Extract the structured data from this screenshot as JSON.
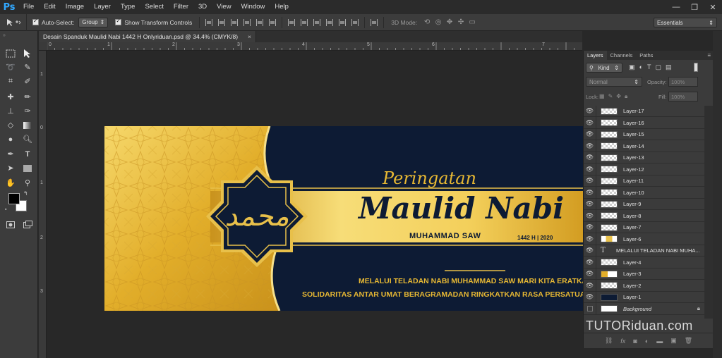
{
  "app": {
    "logo": "Ps"
  },
  "menu": [
    "File",
    "Edit",
    "Image",
    "Layer",
    "Type",
    "Select",
    "Filter",
    "3D",
    "View",
    "Window",
    "Help"
  ],
  "window_controls": {
    "minimize": "—",
    "restore": "❐",
    "close": "✕"
  },
  "options_bar": {
    "auto_select_label": "Auto-Select:",
    "auto_select_value": "Group",
    "transform_label": "Show Transform Controls",
    "mode_3d_label": "3D Mode:",
    "workspace": "Essentials"
  },
  "document": {
    "tab_title": "Desain Spanduk Maulid Nabi 1442 H Onlyriduan.psd @ 34.4% (CMYK/8)",
    "close": "×"
  },
  "rulers": {
    "top": [
      "0",
      "1",
      "2",
      "3",
      "4",
      "5",
      "6",
      "7"
    ],
    "left": [
      "1",
      "0",
      "1",
      "2",
      "3"
    ]
  },
  "banner": {
    "peringatan": "Peringatan",
    "title": "Maulid Nabi",
    "subtitle": "MUHAMMAD SAW",
    "year": "1442 H | 2020",
    "line1": "MELALUI TELADAN NABI MUHAMMAD SAW MARI KITA ERATKAN",
    "line2": "SOLIDARITAS ANTAR UMAT BERAGRAMADAN RINGKATKAN RASA PERSATUAN KESA",
    "calligraphy": "محمد",
    "colors": {
      "navy": "#0d1b34",
      "gold": "#e7b833",
      "gold_light": "#f6d86b"
    }
  },
  "layers_panel": {
    "tabs": [
      "Layers",
      "Channels",
      "Paths"
    ],
    "kind_label": "Kind",
    "blend_mode": "Normal",
    "opacity_label": "Opacity:",
    "opacity_value": "100%",
    "lock_label": "Lock:",
    "fill_label": "Fill:",
    "fill_value": "100%",
    "layers": [
      {
        "name": "Layer-17",
        "type": "pixel"
      },
      {
        "name": "Layer-16",
        "type": "pixel"
      },
      {
        "name": "Layer-15",
        "type": "pixel"
      },
      {
        "name": "Layer-14",
        "type": "pixel"
      },
      {
        "name": "Layer-13",
        "type": "pixel"
      },
      {
        "name": "Layer-12",
        "type": "pixel"
      },
      {
        "name": "Layer-11",
        "type": "pixel"
      },
      {
        "name": "Layer-10",
        "type": "pixel"
      },
      {
        "name": "Layer-9",
        "type": "pixel"
      },
      {
        "name": "Layer-8",
        "type": "pixel"
      },
      {
        "name": "Layer-7",
        "type": "pixel"
      },
      {
        "name": "Layer-6",
        "type": "pixel"
      },
      {
        "name": "MELALUI TELADAN NABI MUHA...",
        "type": "text"
      },
      {
        "name": "Layer-4",
        "type": "pixel"
      },
      {
        "name": "Layer-3",
        "type": "pixel"
      },
      {
        "name": "Layer-2",
        "type": "pixel"
      },
      {
        "name": "Layer-1",
        "type": "pixel"
      },
      {
        "name": "Background",
        "type": "background"
      }
    ]
  },
  "watermark": "TUTORiduan.com"
}
